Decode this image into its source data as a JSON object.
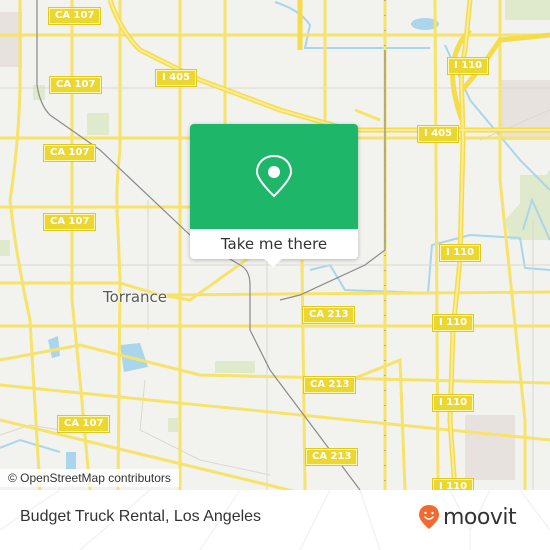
{
  "map": {
    "place_labels": [
      {
        "id": "torrance",
        "text": "Torrance"
      }
    ],
    "road_shields": [
      {
        "id": "ca107-a",
        "text": "CA 107"
      },
      {
        "id": "i405-a",
        "text": "I 405"
      },
      {
        "id": "i110-a",
        "text": "I 110"
      },
      {
        "id": "ca107-b",
        "text": "CA 107"
      },
      {
        "id": "i405-b",
        "text": "I 405"
      },
      {
        "id": "ca107-c",
        "text": "CA 107"
      },
      {
        "id": "ca107-d",
        "text": "CA 107"
      },
      {
        "id": "i110-b",
        "text": "I 110"
      },
      {
        "id": "ca213-a",
        "text": "CA 213"
      },
      {
        "id": "i110-c",
        "text": "I 110"
      },
      {
        "id": "ca213-b",
        "text": "CA 213"
      },
      {
        "id": "i110-d",
        "text": "I 110"
      },
      {
        "id": "ca107-e",
        "text": "CA 107"
      },
      {
        "id": "ca213-c",
        "text": "CA 213"
      },
      {
        "id": "i110-e",
        "text": "I 110"
      }
    ],
    "colors": {
      "background": "#f2f2ee",
      "road": "#f7e36a",
      "water": "#a9d6ec",
      "park": "#d8eac0",
      "rail": "#777777",
      "popup_green": "#1eb668"
    }
  },
  "popup": {
    "icon": "map-pin-icon",
    "cta_label": "Take me there"
  },
  "attribution": "© OpenStreetMap contributors",
  "footer": {
    "title": "Budget Truck Rental, Los Angeles",
    "logo_text": "moovit",
    "logo_icon": "moovit-smile-pin-icon",
    "logo_color": "#f26a32"
  }
}
